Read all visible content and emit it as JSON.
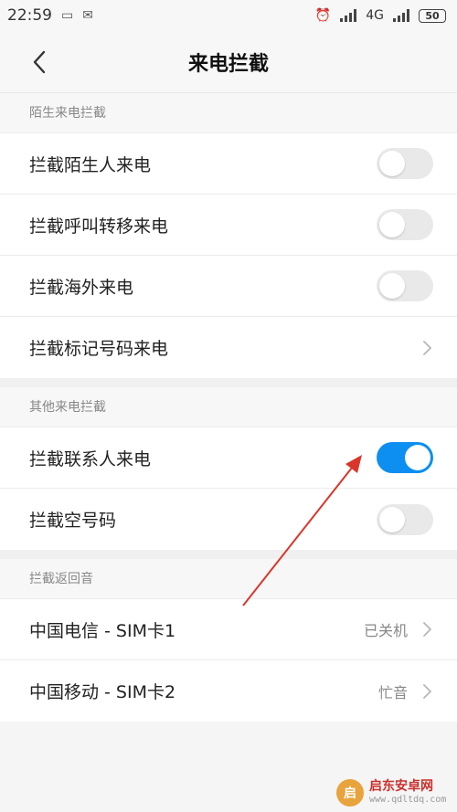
{
  "status_bar": {
    "time": "22:59",
    "network": "4G",
    "battery": "50"
  },
  "nav": {
    "title": "来电拦截"
  },
  "sections": [
    {
      "header": "陌生来电拦截",
      "items": [
        {
          "label": "拦截陌生人来电",
          "control": "toggle",
          "on": false
        },
        {
          "label": "拦截呼叫转移来电",
          "control": "toggle",
          "on": false
        },
        {
          "label": "拦截海外来电",
          "control": "toggle",
          "on": false
        },
        {
          "label": "拦截标记号码来电",
          "control": "chevron"
        }
      ]
    },
    {
      "header": "其他来电拦截",
      "items": [
        {
          "label": "拦截联系人来电",
          "control": "toggle",
          "on": true
        },
        {
          "label": "拦截空号码",
          "control": "toggle",
          "on": false
        }
      ]
    },
    {
      "header": "拦截返回音",
      "items": [
        {
          "label": "中国电信 - SIM卡1",
          "control": "chevron",
          "value": "已关机"
        },
        {
          "label": "中国移动 - SIM卡2",
          "control": "chevron",
          "value": "忙音"
        }
      ]
    }
  ],
  "colors": {
    "toggle_on": "#0c8ff0",
    "toggle_off": "#e9e9e9",
    "annotation_arrow": "#d9362b"
  },
  "watermark": {
    "name": "启东安卓网",
    "url": "www.qdltdq.com"
  }
}
